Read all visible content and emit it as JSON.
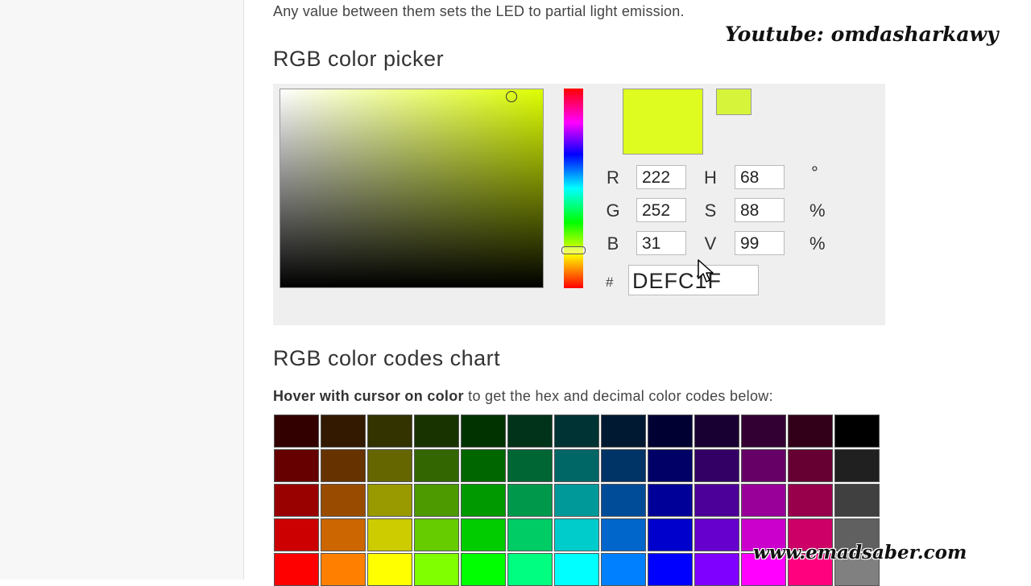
{
  "intro_text": "Any value between them sets the LED to partial light emission.",
  "watermark_top": "Youtube: omdasharkawy",
  "watermark_bottom": "www.emadsaber.com",
  "picker": {
    "title": "RGB color picker",
    "current_color": "#DEFC1F",
    "previous_color": "#D6F53A",
    "fields": {
      "r": {
        "label": "R",
        "value": "222"
      },
      "g": {
        "label": "G",
        "value": "252"
      },
      "b": {
        "label": "B",
        "value": "31"
      },
      "h": {
        "label": "H",
        "value": "68",
        "unit": "°"
      },
      "s": {
        "label": "S",
        "value": "88",
        "unit": "%"
      },
      "v": {
        "label": "V",
        "value": "99",
        "unit": "%"
      }
    },
    "hash_label": "#",
    "hex_value": "DEFC1F"
  },
  "chart": {
    "title": "RGB color codes chart",
    "desc_bold": "Hover with cursor on color",
    "desc_rest": " to get the hex and decimal color codes below:",
    "rows": [
      [
        "#330000",
        "#331900",
        "#333300",
        "#193300",
        "#003300",
        "#003319",
        "#003333",
        "#001933",
        "#000033",
        "#190033",
        "#330033",
        "#330019",
        "#000000"
      ],
      [
        "#660000",
        "#663300",
        "#666600",
        "#336600",
        "#006600",
        "#006633",
        "#006666",
        "#003366",
        "#000066",
        "#330066",
        "#660066",
        "#660033",
        "#202020"
      ],
      [
        "#990000",
        "#994C00",
        "#999900",
        "#4C9900",
        "#009900",
        "#00994C",
        "#009999",
        "#004C99",
        "#000099",
        "#4C0099",
        "#990099",
        "#99004C",
        "#404040"
      ],
      [
        "#CC0000",
        "#CC6600",
        "#CCCC00",
        "#66CC00",
        "#00CC00",
        "#00CC66",
        "#00CCCC",
        "#0066CC",
        "#0000CC",
        "#6600CC",
        "#CC00CC",
        "#CC0066",
        "#606060"
      ],
      [
        "#FF0000",
        "#FF8000",
        "#FFFF00",
        "#80FF00",
        "#00FF00",
        "#00FF80",
        "#00FFFF",
        "#0080FF",
        "#0000FF",
        "#7F00FF",
        "#FF00FF",
        "#FF007F",
        "#808080"
      ]
    ]
  }
}
